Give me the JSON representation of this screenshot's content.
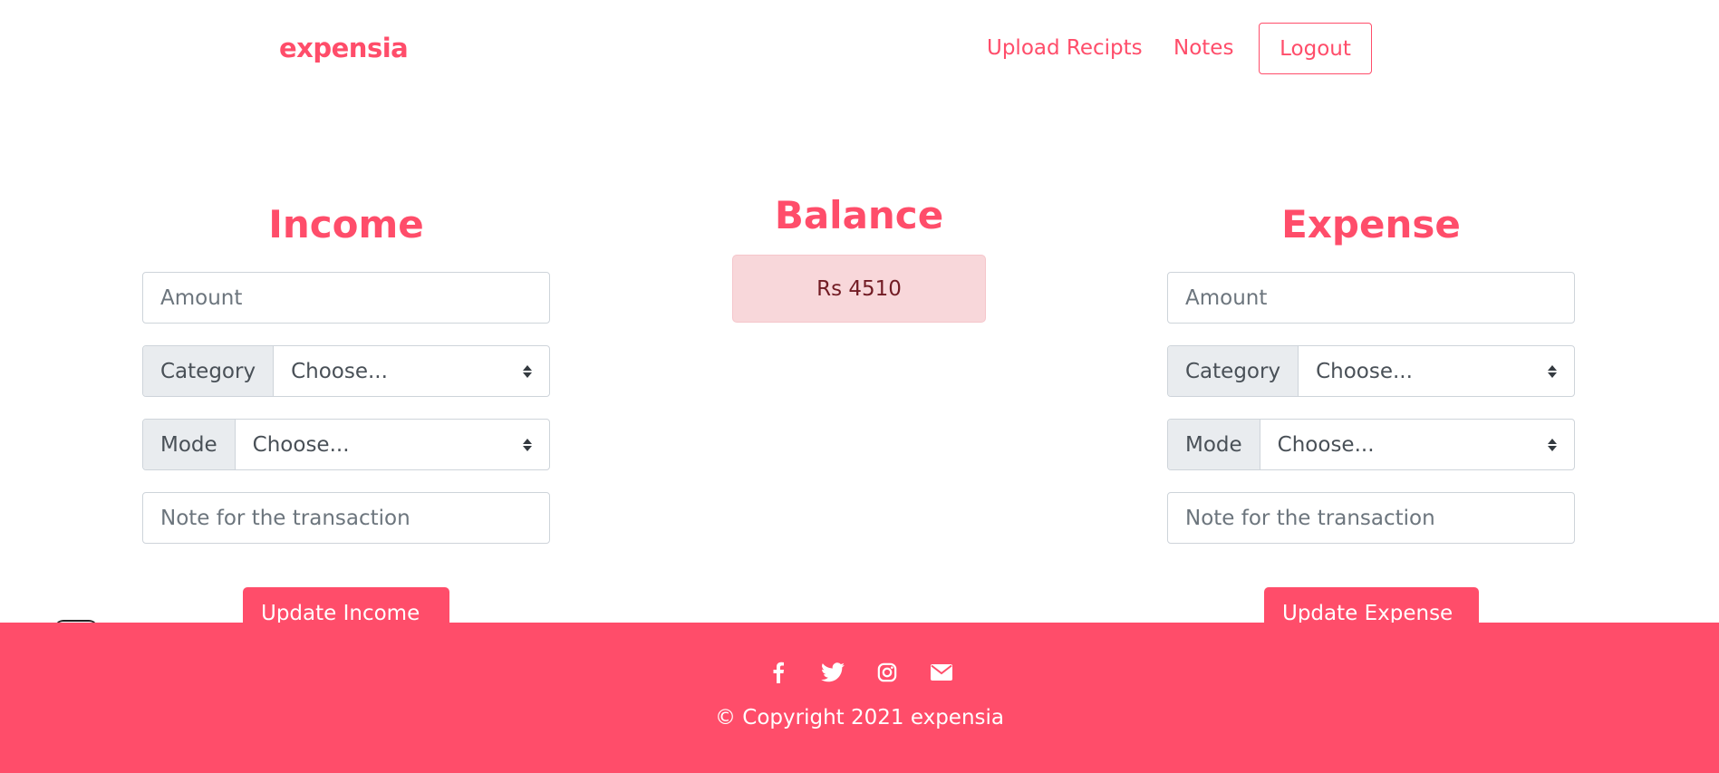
{
  "navbar": {
    "brand": "expensia",
    "links": [
      "Upload Recipts",
      "Notes"
    ],
    "logout_label": "Logout"
  },
  "income": {
    "heading": "Income",
    "amount_placeholder": "Amount",
    "category_label": "Category",
    "category_value": "Choose...",
    "mode_label": "Mode",
    "mode_value": "Choose...",
    "note_placeholder": "Note for the transaction",
    "submit_label": "Update Income"
  },
  "balance": {
    "heading": "Balance",
    "value": "Rs 4510"
  },
  "expense": {
    "heading": "Expense",
    "amount_placeholder": "Amount",
    "category_label": "Category",
    "category_value": "Choose...",
    "mode_label": "Mode",
    "mode_value": "Choose...",
    "note_placeholder": "Note for the transaction",
    "submit_label": "Update Expense"
  },
  "footer": {
    "social_icons": [
      "facebook-icon",
      "twitter-icon",
      "instagram-icon",
      "envelope-icon"
    ],
    "copyright": "© Copyright 2021 expensia"
  },
  "colors": {
    "accent": "#ff4d6a",
    "balance_bg": "#f8d7da",
    "balance_text": "#721c24"
  }
}
